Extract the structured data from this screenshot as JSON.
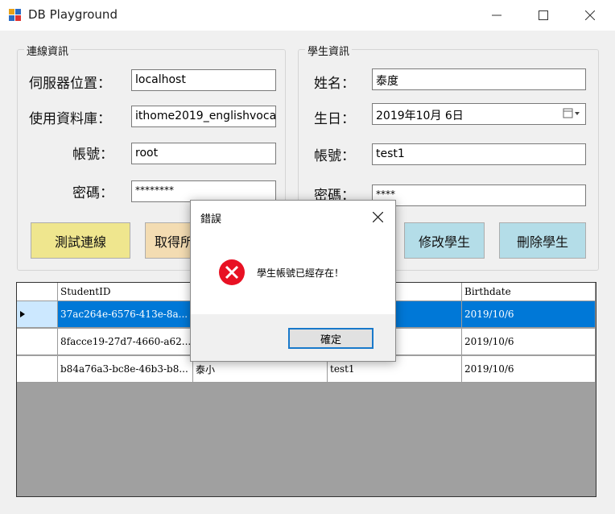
{
  "window": {
    "title": "DB Playground"
  },
  "connection": {
    "group_title": "連線資訊",
    "server_label": "伺服器位置：",
    "server_value": "localhost",
    "database_label": "使用資料庫：",
    "database_value": "ithome2019_englishvoca",
    "account_label": "帳號：",
    "account_value": "root",
    "password_label": "密碼：",
    "password_value": "********",
    "test_button": "測試連線",
    "fetch_button": "取得所"
  },
  "student": {
    "group_title": "學生資訊",
    "name_label": "姓名：",
    "name_value": "泰度",
    "birthday_label": "生日：",
    "birthday_value": "2019年10月  6日",
    "account_label": "帳號：",
    "account_value": "test1",
    "password_label": "密碼：",
    "password_value": "****",
    "update_button": "修改學生",
    "delete_button": "刪除學生"
  },
  "grid": {
    "columns": [
      "",
      "StudentID",
      "",
      "",
      "Birthdate"
    ],
    "rows": [
      [
        "37ac264e-6576-413e-8a...",
        "",
        "",
        "2019/10/6"
      ],
      [
        "8facce19-27d7-4660-a62...",
        "",
        "",
        "2019/10/6"
      ],
      [
        "b84a76a3-bc8e-46b3-b8...",
        "泰小",
        "test1",
        "2019/10/6"
      ]
    ],
    "selected_row": 0
  },
  "dialog": {
    "title": "錯誤",
    "message": "學生帳號已經存在！",
    "ok_button": "確定"
  },
  "colors": {
    "yellow_button": "#efe68e",
    "tan_button": "#f3dcb2",
    "blue_button": "#b4dde8",
    "selection": "#0078d7",
    "error_icon": "#e81123"
  }
}
